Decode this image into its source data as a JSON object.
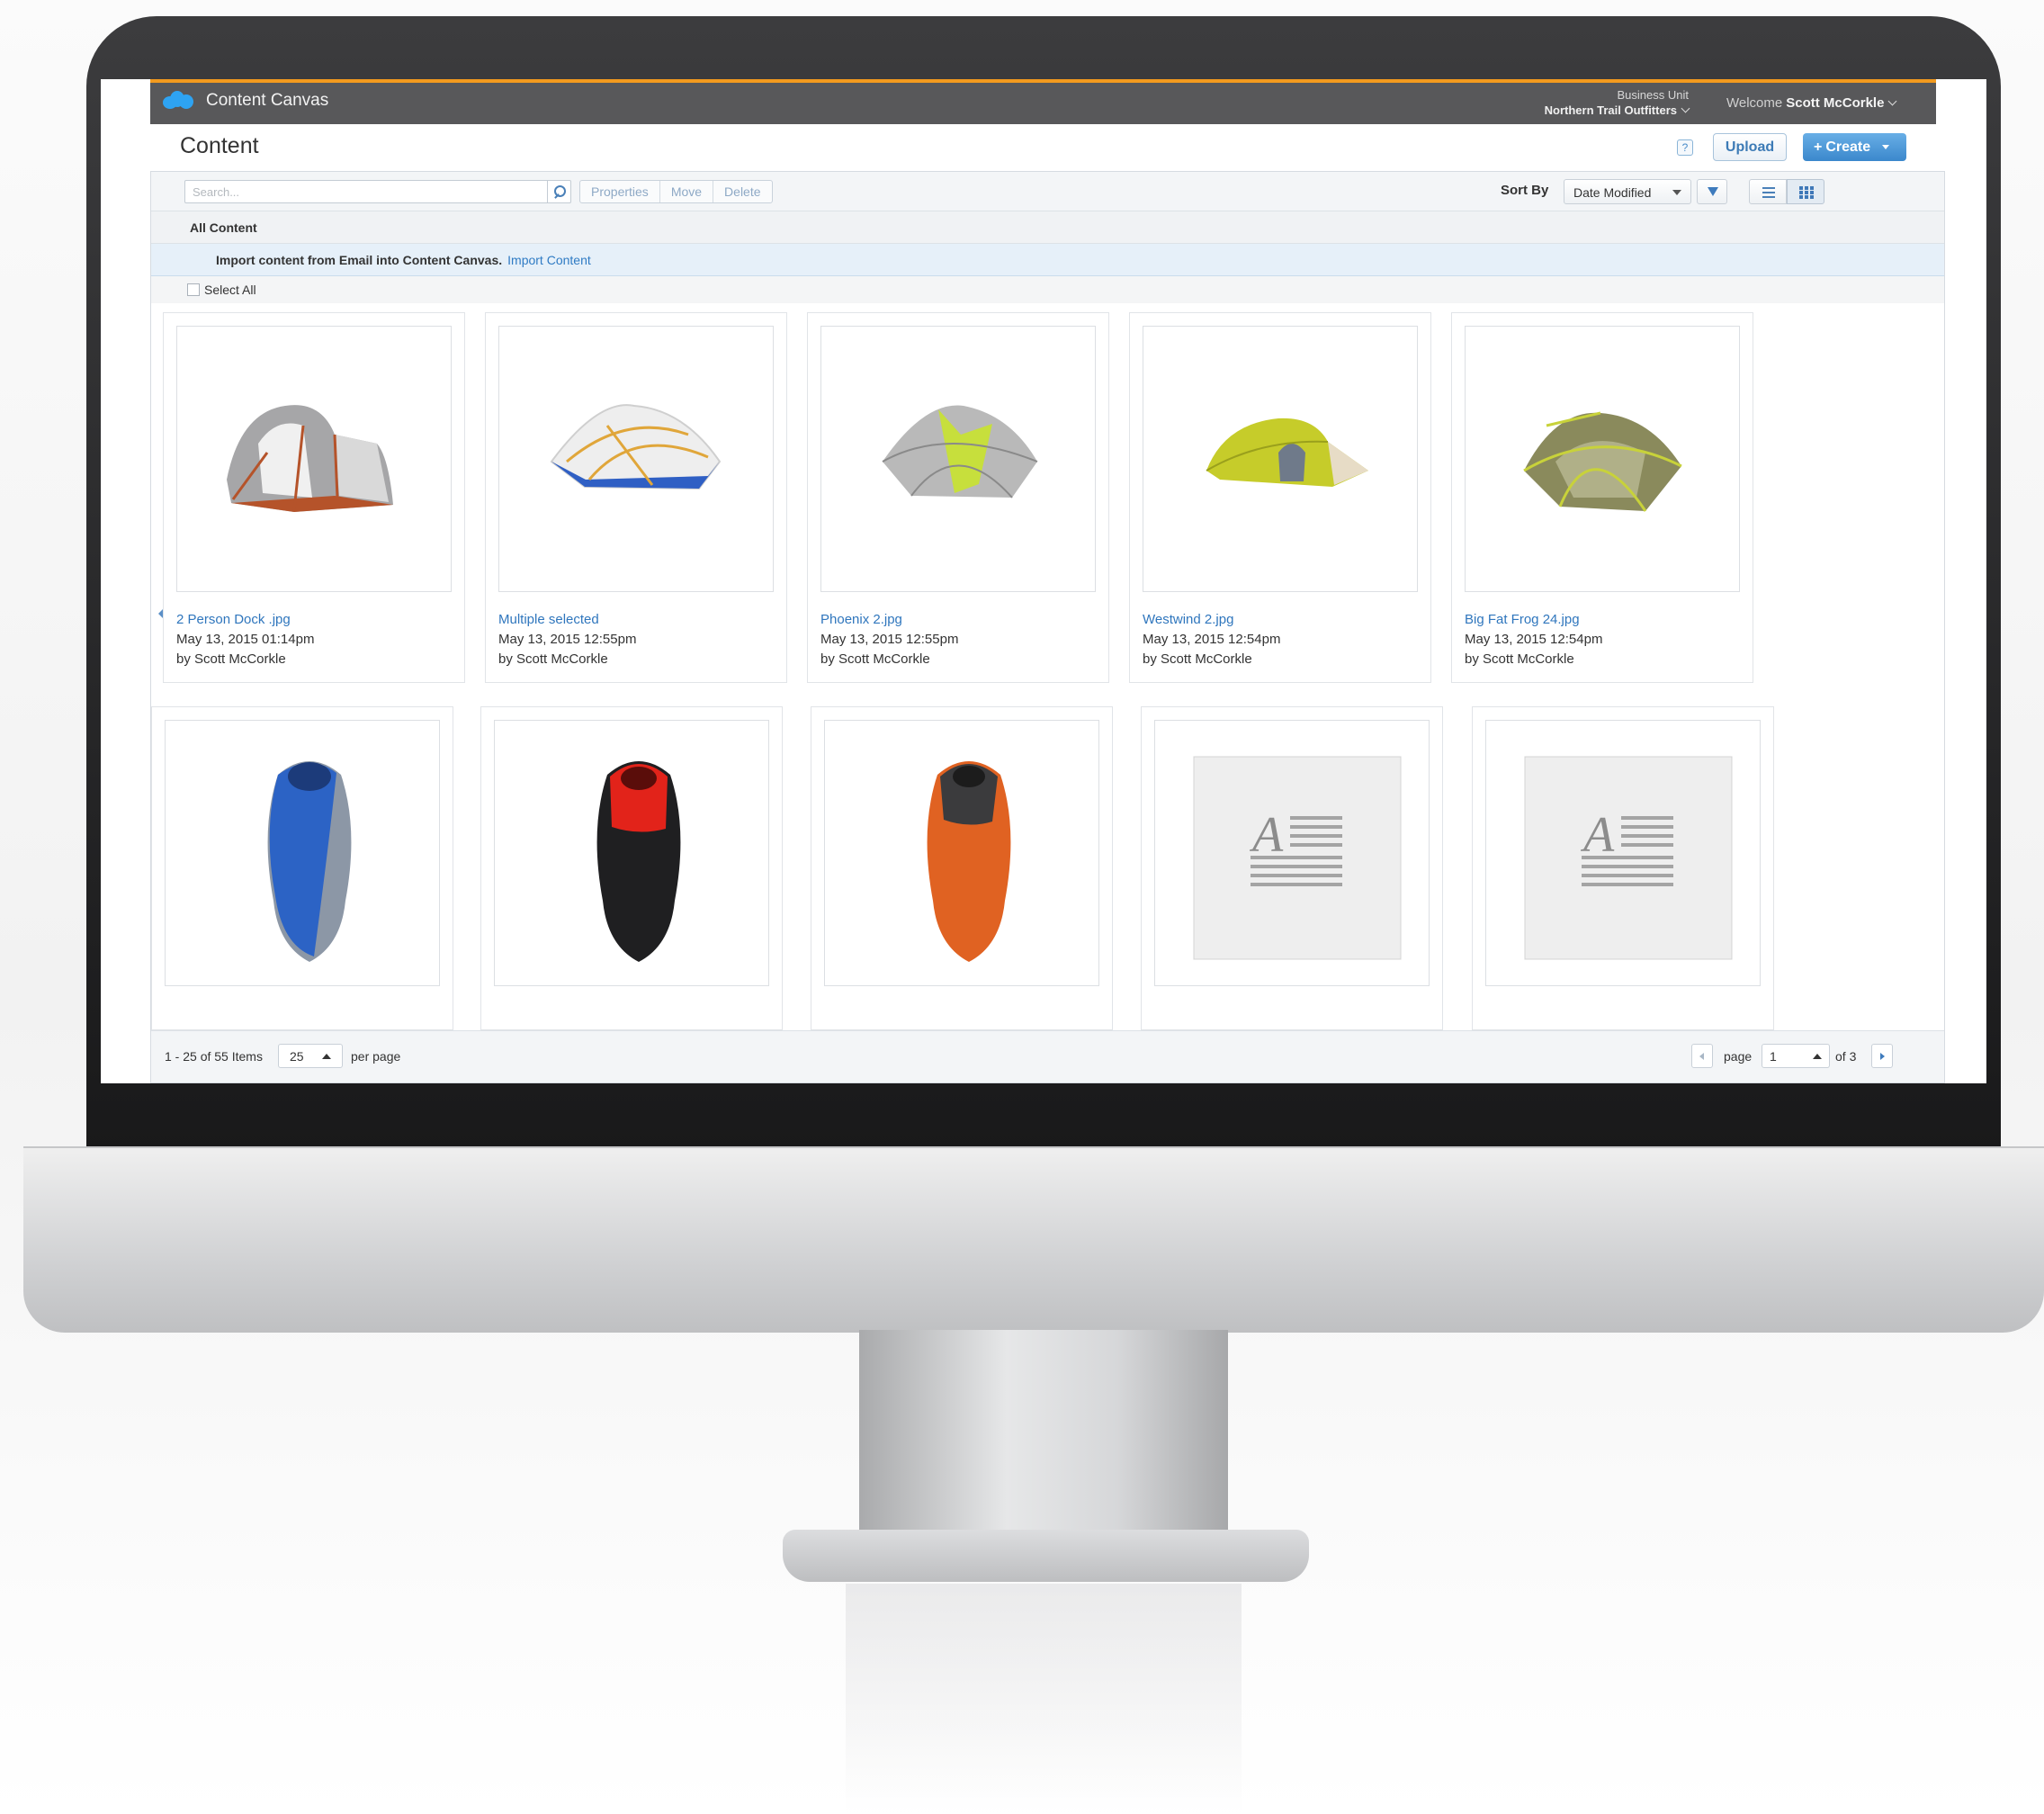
{
  "app": {
    "title": "Content Canvas",
    "accent_color": "#f39a1e",
    "topbar_color": "#58585a"
  },
  "header": {
    "business_unit_label": "Business Unit",
    "business_unit_value": "Northern Trail Outfitters",
    "welcome_label": "Welcome",
    "user_name": "Scott McCorkle"
  },
  "page": {
    "title": "Content",
    "help_label": "?",
    "upload_label": "Upload",
    "create_label": "Create"
  },
  "toolbar": {
    "search_placeholder": "Search...",
    "properties_label": "Properties",
    "move_label": "Move",
    "delete_label": "Delete",
    "sort_by_label": "Sort By",
    "sort_value": "Date Modified"
  },
  "folder": {
    "title": "All Content",
    "import_message": "Import content from Email into Content Canvas.",
    "import_link": "Import Content",
    "select_all_label": "Select All"
  },
  "items": [
    {
      "name": "2 Person Dock .jpg",
      "date": "May 13, 2015 01:14pm",
      "author": "by Scott McCorkle",
      "icon": "tent-dome-orange"
    },
    {
      "name": "Multiple selected",
      "date": "May 13, 2015 12:55pm",
      "author": "by Scott McCorkle",
      "icon": "tent-white-blue"
    },
    {
      "name": "Phoenix 2.jpg",
      "date": "May 13, 2015 12:55pm",
      "author": "by Scott McCorkle",
      "icon": "tent-grey-green"
    },
    {
      "name": "Westwind 2.jpg",
      "date": "May 13, 2015 12:54pm",
      "author": "by Scott McCorkle",
      "icon": "tent-yellow"
    },
    {
      "name": "Big Fat Frog 24.jpg",
      "date": "May 13, 2015 12:54pm",
      "author": "by Scott McCorkle",
      "icon": "tent-olive"
    },
    {
      "icon": "sleeping-bag-blue"
    },
    {
      "icon": "sleeping-bag-red"
    },
    {
      "icon": "sleeping-bag-orange"
    },
    {
      "icon": "text-document"
    },
    {
      "icon": "text-document"
    }
  ],
  "pagination": {
    "range_label": "1 - 25 of 55 Items",
    "per_page_value": "25",
    "per_page_label": "per page",
    "page_word": "page",
    "current_page": "1",
    "of_label": "of 3"
  }
}
